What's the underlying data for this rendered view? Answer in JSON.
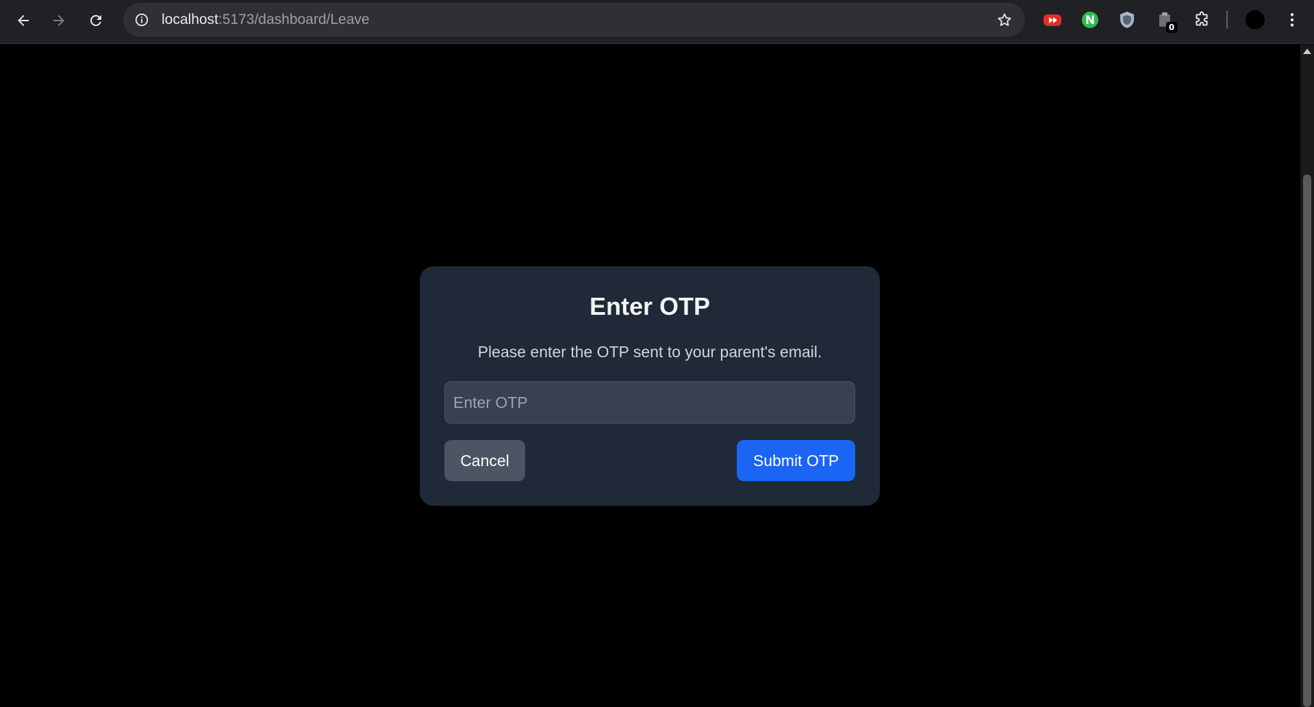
{
  "browser": {
    "url_host": "localhost",
    "url_path": ":5173/dashboard/Leave",
    "extensions": [
      {
        "name": "video-speed-extension-icon",
        "color": "#e52d27"
      },
      {
        "name": "n-extension-icon",
        "color": "#2dbd4e"
      },
      {
        "name": "shield-extension-icon",
        "color": "#aab4c8"
      },
      {
        "name": "clipboard-extension-icon",
        "badge": "0"
      },
      {
        "name": "puzzle-extensions-icon"
      }
    ]
  },
  "modal": {
    "title": "Enter OTP",
    "description": "Please enter the OTP sent to your parent's email.",
    "input": {
      "placeholder": "Enter OTP",
      "value": ""
    },
    "cancel_label": "Cancel",
    "submit_label": "Submit OTP"
  },
  "colors": {
    "page_background": "#000000",
    "modal_background": "#1f2937",
    "input_background": "#374151",
    "cancel_button": "#4b5563",
    "submit_button": "#1a65f3"
  }
}
